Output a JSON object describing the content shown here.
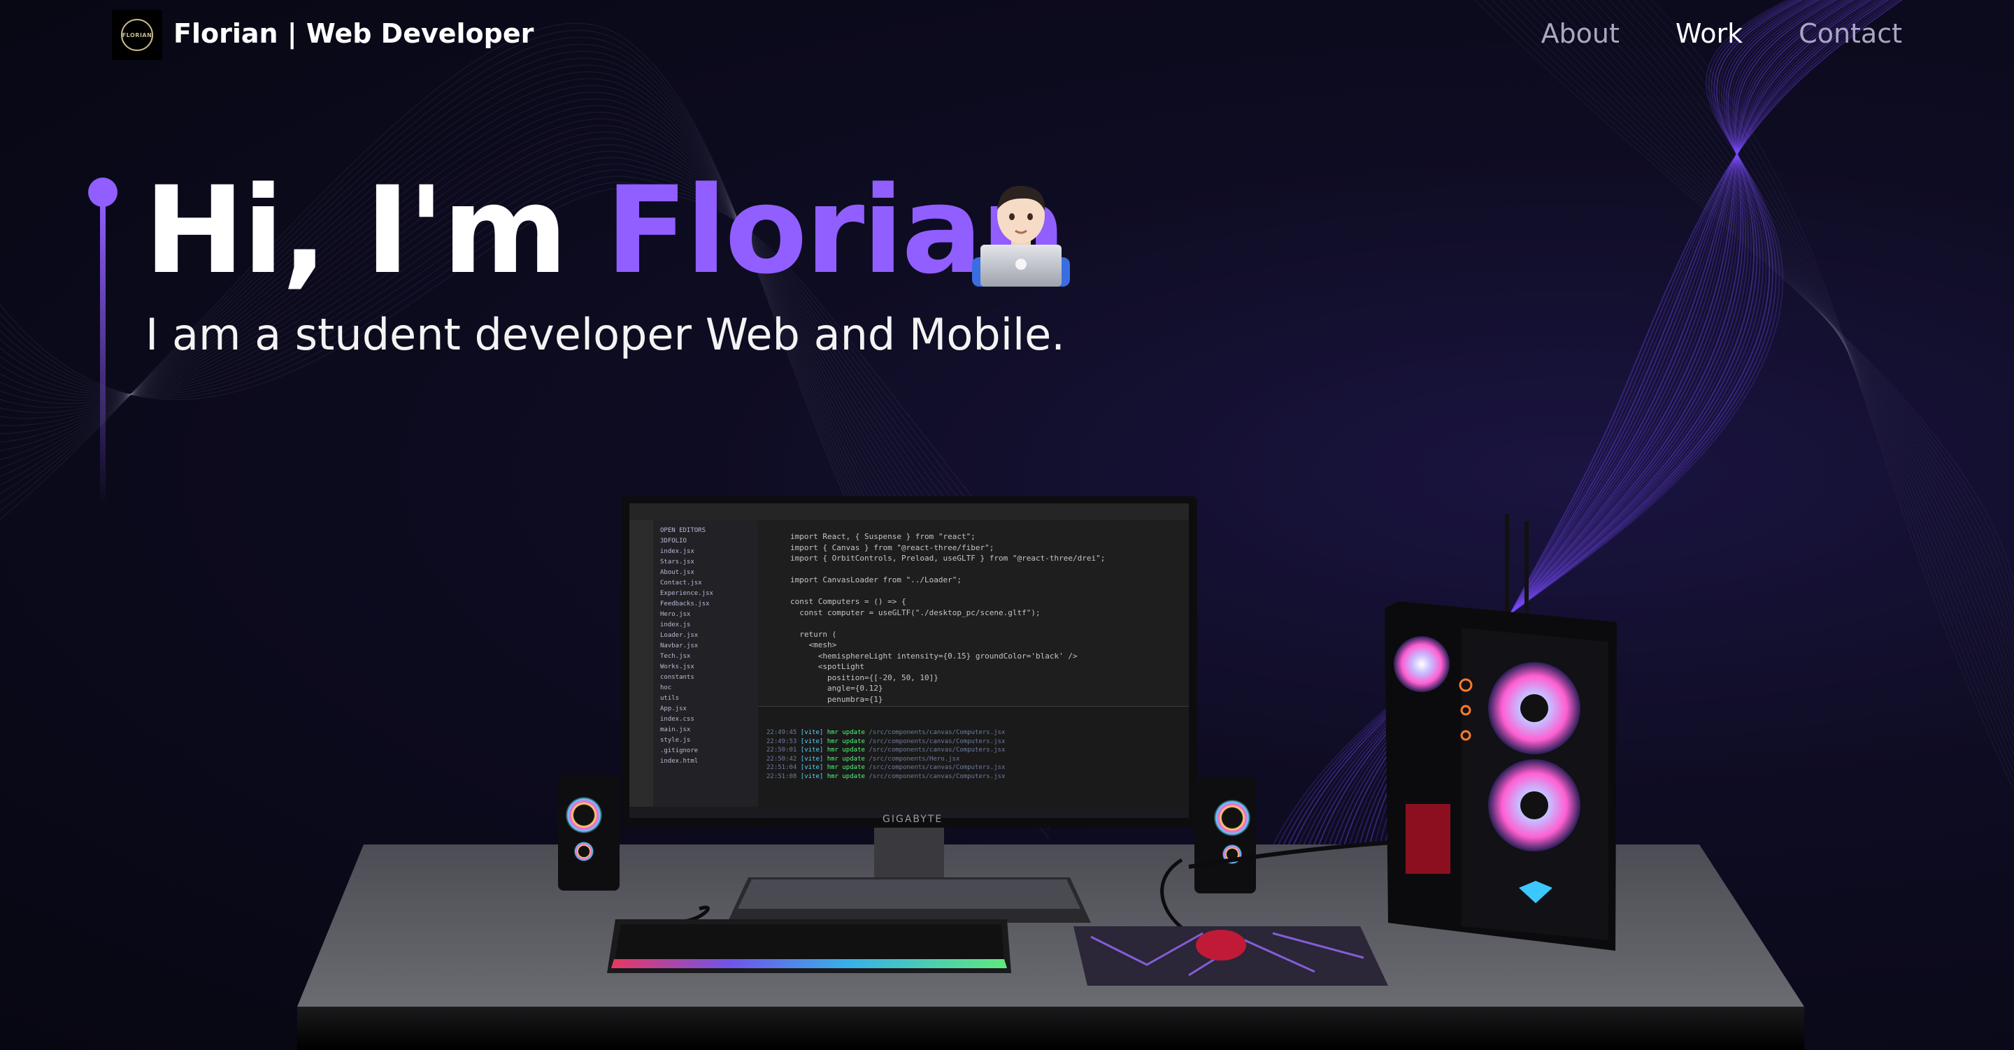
{
  "nav": {
    "brand": "Florian  | Web Developer",
    "logo_text": "FLORIAN",
    "links": [
      {
        "label": "About"
      },
      {
        "label": "Work"
      },
      {
        "label": "Contact"
      }
    ]
  },
  "hero": {
    "greeting": "Hi, I'm ",
    "name": "Florian",
    "subtitle": "I am a student developer Web and Mobile.",
    "emoji": "man-technologist-emoji"
  },
  "scene": {
    "monitor_brand": "GIGABYTE",
    "editor_lines": [
      "import React, { Suspense } from \"react\";",
      "import { Canvas } from \"@react-three/fiber\";",
      "import { OrbitControls, Preload, useGLTF } from \"@react-three/drei\";",
      "",
      "import CanvasLoader from \"../Loader\";",
      "",
      "const Computers = () => {",
      "  const computer = useGLTF(\"./desktop_pc/scene.gltf\");",
      "",
      "  return (",
      "    <mesh>",
      "      <hemisphereLight intensity={0.15} groundColor='black' />",
      "      <spotLight",
      "        position={[-20, 50, 10]}",
      "        angle={0.12}",
      "        penumbra={1}"
    ],
    "file_tree": [
      "OPEN EDITORS",
      "3DFOLIO",
      "index.jsx",
      "Stars.jsx",
      "About.jsx",
      "Contact.jsx",
      "Experience.jsx",
      "Feedbacks.jsx",
      "Hero.jsx",
      "index.js",
      "Loader.jsx",
      "Navbar.jsx",
      "Tech.jsx",
      "Works.jsx",
      "constants",
      "hoc",
      "utils",
      "App.jsx",
      "index.css",
      "main.jsx",
      "style.js",
      ".gitignore",
      "index.html"
    ]
  },
  "colors": {
    "accent": "#915eff",
    "background": "#0b0a1a",
    "nav_inactive": "#aaa6c3",
    "text": "#ffffff"
  }
}
